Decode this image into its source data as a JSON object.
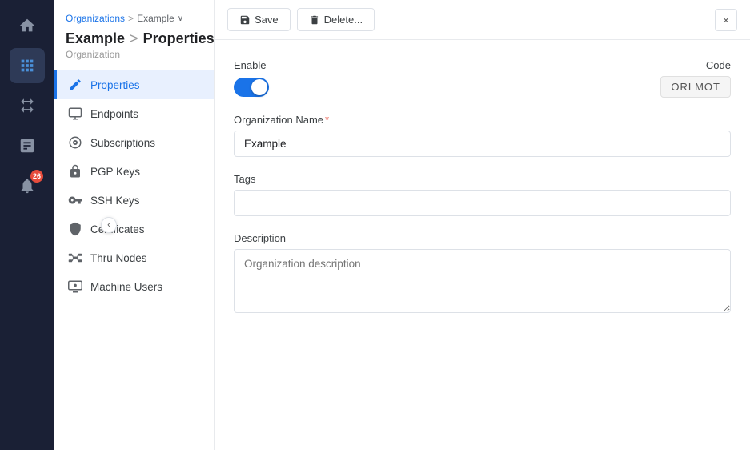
{
  "sidebar": {
    "icons": [
      {
        "name": "home-icon",
        "label": "Home",
        "active": false,
        "unicode": "⌂"
      },
      {
        "name": "org-icon",
        "label": "Organizations",
        "active": true,
        "unicode": "▦"
      },
      {
        "name": "switch-icon",
        "label": "Switch",
        "active": false,
        "unicode": "⇄"
      },
      {
        "name": "report-icon",
        "label": "Reports",
        "active": false,
        "unicode": "☰"
      },
      {
        "name": "bell-icon",
        "label": "Notifications",
        "active": false,
        "unicode": "🔔",
        "badge": "26"
      }
    ],
    "collapse_arrow": "‹"
  },
  "nav": {
    "breadcrumb": {
      "organizations_link": "Organizations",
      "separator": ">",
      "example_label": "Example",
      "dropdown_arrow": "∨"
    },
    "page_title": "Example",
    "page_title_sep": ">",
    "page_subtitle_label": "Properties",
    "org_type": "Organization",
    "items": [
      {
        "id": "properties",
        "label": "Properties",
        "active": true
      },
      {
        "id": "endpoints",
        "label": "Endpoints",
        "active": false
      },
      {
        "id": "subscriptions",
        "label": "Subscriptions",
        "active": false
      },
      {
        "id": "pgp-keys",
        "label": "PGP Keys",
        "active": false
      },
      {
        "id": "ssh-keys",
        "label": "SSH Keys",
        "active": false
      },
      {
        "id": "certificates",
        "label": "Certificates",
        "active": false
      },
      {
        "id": "thru-nodes",
        "label": "Thru Nodes",
        "active": false
      },
      {
        "id": "machine-users",
        "label": "Machine Users",
        "active": false
      }
    ]
  },
  "toolbar": {
    "save_label": "Save",
    "delete_label": "Delete...",
    "close_label": "×"
  },
  "form": {
    "enable_label": "Enable",
    "toggle_on": true,
    "code_label": "Code",
    "code_value": "ORLMOT",
    "org_name_label": "Organization Name",
    "org_name_required": true,
    "org_name_value": "Example",
    "tags_label": "Tags",
    "tags_value": "",
    "description_label": "Description",
    "description_placeholder": "Organization description"
  }
}
